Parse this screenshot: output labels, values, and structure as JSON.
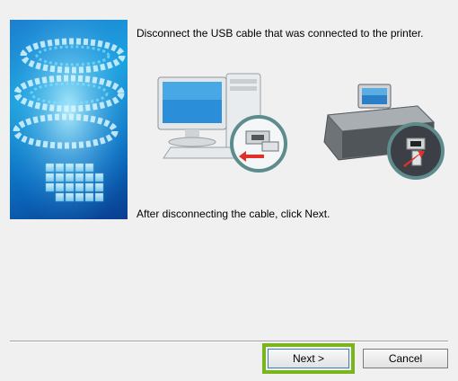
{
  "dialog": {
    "instruction": "Disconnect the USB cable that was connected to the printer.",
    "after_text": "After disconnecting the cable, click Next."
  },
  "buttons": {
    "next_label": "Next >",
    "cancel_label": "Cancel"
  },
  "illustrations": {
    "computer_icon": "desktop-computer-with-usb-disconnect",
    "printer_icon": "printer-with-usb-disconnect"
  },
  "colors": {
    "highlight": "#7ab51d",
    "disconnect_arrow": "#e0302a",
    "banner_blue": "#1aa3e0"
  }
}
